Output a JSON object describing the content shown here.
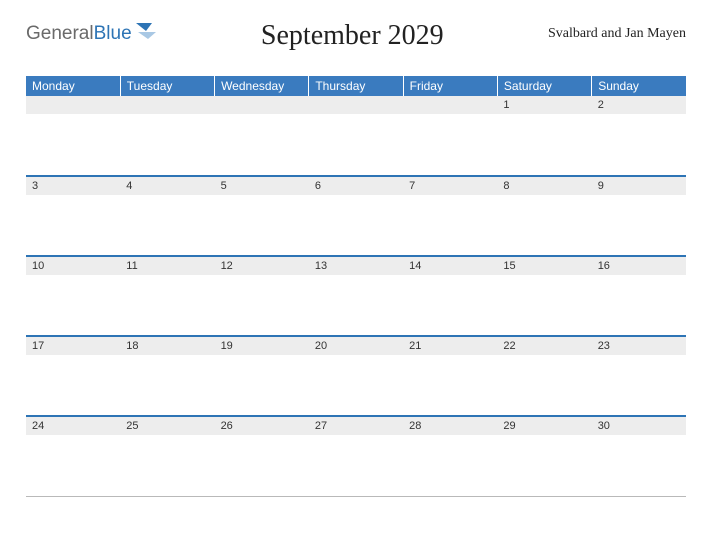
{
  "brand": {
    "part1": "General",
    "part2": "Blue"
  },
  "title": "September 2029",
  "region": "Svalbard and Jan Mayen",
  "colors": {
    "accent": "#2d74b5",
    "header_bg": "#3a7bbf",
    "strip_bg": "#ededed"
  },
  "weekdays": [
    "Monday",
    "Tuesday",
    "Wednesday",
    "Thursday",
    "Friday",
    "Saturday",
    "Sunday"
  ],
  "weeks": [
    [
      "",
      "",
      "",
      "",
      "",
      "1",
      "2"
    ],
    [
      "3",
      "4",
      "5",
      "6",
      "7",
      "8",
      "9"
    ],
    [
      "10",
      "11",
      "12",
      "13",
      "14",
      "15",
      "16"
    ],
    [
      "17",
      "18",
      "19",
      "20",
      "21",
      "22",
      "23"
    ],
    [
      "24",
      "25",
      "26",
      "27",
      "28",
      "29",
      "30"
    ]
  ]
}
